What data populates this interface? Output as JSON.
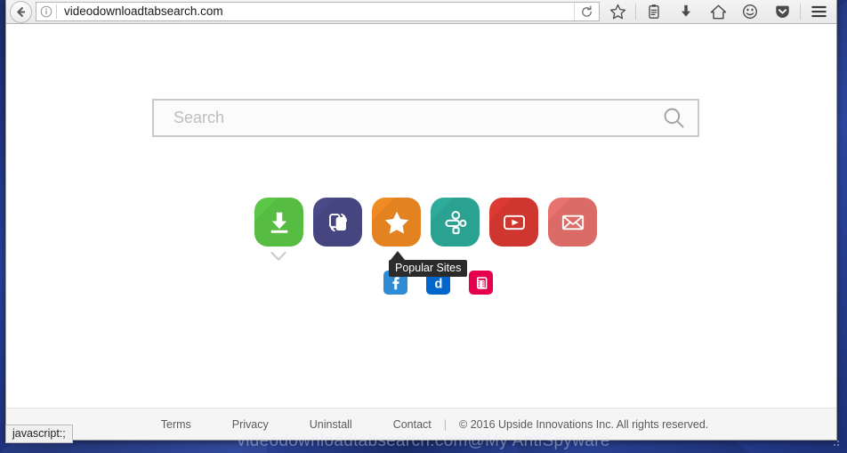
{
  "desktop": {
    "wallpaper_color": "#223a86",
    "watermark": "videodownloadtabsearch.com@My AntiSpyware"
  },
  "browser": {
    "back_button_label": "Back",
    "info_icon": "info-icon",
    "url": "videodownloadtabsearch.com",
    "reload_label": "Reload",
    "toolbar_icons": [
      {
        "name": "bookmark-star-icon",
        "label": "Bookmark this page"
      },
      {
        "name": "library-icon",
        "label": "Show your bookmarks"
      },
      {
        "name": "downloads-icon",
        "label": "Downloads"
      },
      {
        "name": "home-icon",
        "label": "Home"
      },
      {
        "name": "sync-smiley-icon",
        "label": "Firefox Account"
      },
      {
        "name": "pocket-icon",
        "label": "Save to Pocket"
      },
      {
        "name": "hamburger-menu-icon",
        "label": "Open menu"
      }
    ],
    "status_popup": "javascript:;"
  },
  "search": {
    "value": "",
    "placeholder": "Search",
    "submit_icon": "magnifier-icon"
  },
  "app_tiles": [
    {
      "name": "download-tile",
      "icon": "download-arrow-icon",
      "label": "Download",
      "color": "#5cc746"
    },
    {
      "name": "convert-tile",
      "icon": "file-transfer-icon",
      "label": "Convert",
      "color": "#494a87"
    },
    {
      "name": "favorites-tile",
      "icon": "star-icon",
      "label": "Favorites",
      "color": "#f08a23"
    },
    {
      "name": "network-tile",
      "icon": "sitemap-icon",
      "label": "Network",
      "color": "#2eab9b"
    },
    {
      "name": "youtube-tile",
      "icon": "play-video-icon",
      "label": "YouTube",
      "color": "#dd3a33"
    },
    {
      "name": "mail-tile",
      "icon": "envelope-icon",
      "label": "Mail",
      "color": "#e8726e"
    }
  ],
  "chevron": {
    "name": "chevron-down-icon",
    "color": "#cccccc"
  },
  "tooltip": {
    "text": "Popular Sites"
  },
  "small_tiles": [
    {
      "name": "facebook-site-tile",
      "icon": "facebook-f-icon",
      "label": "Facebook",
      "color": "#2e8bd4",
      "glyph": "f"
    },
    {
      "name": "dailymotion-site-tile",
      "icon": "letter-d-icon",
      "label": "Dailymotion",
      "color": "#0066cc",
      "glyph": "d"
    },
    {
      "name": "movies-site-tile",
      "icon": "film-strip-icon",
      "label": "Movies",
      "color": "#e5004e",
      "glyph": ""
    }
  ],
  "footer": {
    "links": [
      {
        "name": "terms-link",
        "label": "Terms"
      },
      {
        "name": "privacy-link",
        "label": "Privacy"
      },
      {
        "name": "uninstall-link",
        "label": "Uninstall"
      },
      {
        "name": "contact-link",
        "label": "Contact"
      }
    ],
    "separator": "|",
    "copyright": "© 2016 Upside Innovations Inc. All rights reserved."
  }
}
